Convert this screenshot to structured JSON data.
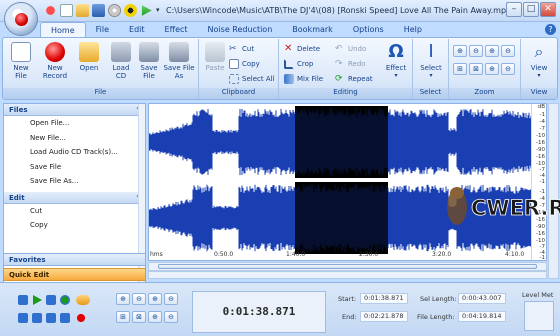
{
  "window": {
    "title": "C:\\Users\\Wincode\\Music\\ATB\\The DJ'4\\(08) [Ronski Speed] Love All The Pain Away.mp3 - [ ..."
  },
  "tabs": [
    "Home",
    "File",
    "Edit",
    "Effect",
    "Noise Reduction",
    "Bookmark",
    "Options",
    "Help"
  ],
  "ribbon": {
    "file_group": {
      "label": "File",
      "buttons": [
        "New File",
        "New Record",
        "Open",
        "Load CD",
        "Save File",
        "Save File As"
      ]
    },
    "clipboard_group": {
      "label": "Clipboard",
      "paste": "Paste",
      "cut": "Cut",
      "copy": "Copy",
      "select_all": "Select All"
    },
    "editing_group": {
      "label": "Editing",
      "delete": "Delete",
      "crop": "Crop",
      "mix_file": "Mix File",
      "undo": "Undo",
      "redo": "Redo",
      "repeat": "Repeat",
      "effect": "Effect"
    },
    "select_group": {
      "label": "Select",
      "button": "Select"
    },
    "zoom_group": {
      "label": "Zoom"
    },
    "view_group": {
      "label": "View",
      "button": "View"
    }
  },
  "task_pane": {
    "files_header": "Files",
    "files_items": [
      "Open File...",
      "New File...",
      "Load Audio CD Track(s)...",
      "Save File",
      "Save File As..."
    ],
    "edit_header": "Edit",
    "edit_items": [
      "Cut",
      "Copy"
    ],
    "favorites": "Favorites",
    "quick_edit": "Quick Edit"
  },
  "waveform": {
    "db_unit": "dB",
    "db_ticks": [
      "-1",
      "-4",
      "-7",
      "-10",
      "-16",
      "-90",
      "-16",
      "-10",
      "-7",
      "-4",
      "-1"
    ],
    "db_ticks_ch2": [
      "-1",
      "-4",
      "-7",
      "-10",
      "-16",
      "-90",
      "-16",
      "-10",
      "-7",
      "-4",
      "-1"
    ],
    "time_labels": [
      "hms",
      "0:50.0",
      "1:40.0",
      "2:30.0",
      "3:20.0",
      "4:10.0"
    ]
  },
  "transport": {
    "current_time": "0:01:38.871",
    "start_label": "Start:",
    "start_value": "0:01:38.871",
    "end_label": "End:",
    "end_value": "0:02:21.878",
    "sel_length_label": "Sel Length:",
    "sel_length_value": "0:00:43.007",
    "file_length_label": "File Length:",
    "file_length_value": "0:04:19.814",
    "level_meter_label": "Level Met"
  },
  "watermark_text": "CWER.RU",
  "colors": {
    "waveform": "#1a3fb2",
    "selection_bg": "#000000",
    "ribbon_text": "#15428b",
    "quick_edit_bg": "#f7a93d"
  }
}
